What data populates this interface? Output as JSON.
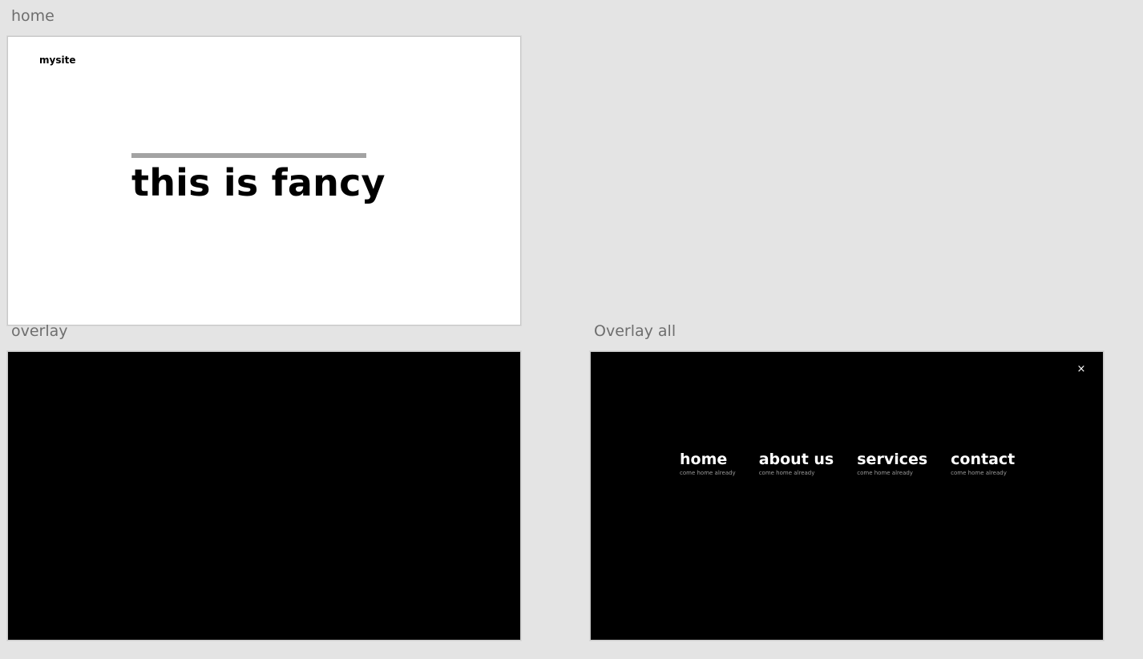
{
  "artboards": {
    "home": {
      "label": "home",
      "logo": "mysite",
      "hero_title": "this is fancy"
    },
    "overlay": {
      "label": "overlay"
    },
    "overlay_all": {
      "label": "Overlay all",
      "close_glyph": "×",
      "menu": [
        {
          "label": "home",
          "sub": "come home already"
        },
        {
          "label": "about us",
          "sub": "come home already"
        },
        {
          "label": "services",
          "sub": "come home already"
        },
        {
          "label": "contact",
          "sub": "come home already"
        }
      ]
    }
  },
  "colors": {
    "canvas_bg": "#e4e4e4",
    "label_gray": "#6e6e6e",
    "hero_rule": "#a3a3a3",
    "overlay_bg": "#000000",
    "menu_text": "#ffffff",
    "menu_sub": "#9a9a9a"
  }
}
